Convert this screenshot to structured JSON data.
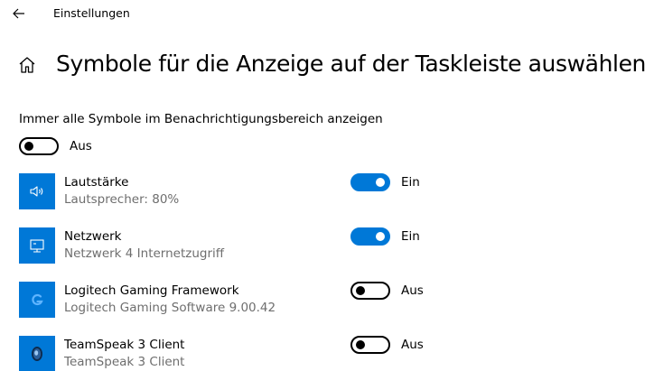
{
  "window": {
    "title": "Einstellungen"
  },
  "page": {
    "title": "Symbole für die Anzeige auf der Taskleiste auswählen"
  },
  "always_show": {
    "label": "Immer alle Symbole im Benachrichtigungsbereich anzeigen",
    "state": "off",
    "state_label": "Aus"
  },
  "apps": [
    {
      "name": "Lautstärke",
      "detail": "Lautsprecher: 80%",
      "state": "on",
      "state_label": "Ein",
      "icon": "speaker-icon"
    },
    {
      "name": "Netzwerk",
      "detail": "Netzwerk 4 Internetzugriff",
      "state": "on",
      "state_label": "Ein",
      "icon": "network-icon"
    },
    {
      "name": "Logitech Gaming Framework",
      "detail": "Logitech Gaming Software 9.00.42",
      "state": "off",
      "state_label": "Aus",
      "icon": "logitech-icon"
    },
    {
      "name": "TeamSpeak 3 Client",
      "detail": "TeamSpeak 3 Client",
      "state": "off",
      "state_label": "Aus",
      "icon": "teamspeak-icon"
    }
  ],
  "colors": {
    "accent": "#0078d7",
    "secondary_text": "#6e6e6e"
  }
}
